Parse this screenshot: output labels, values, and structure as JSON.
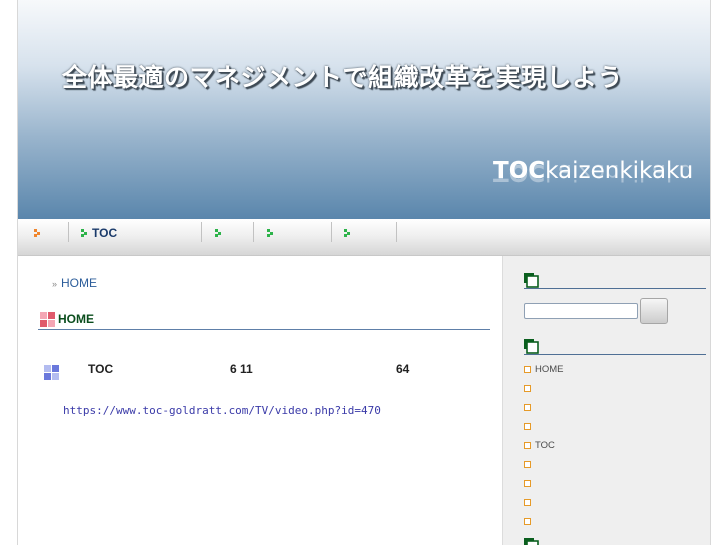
{
  "header": {
    "tagline": "全体最適のマネジメントで組織改革を実現しよう",
    "logo_bold": "TOC",
    "logo_rest": "kaizenkikaku"
  },
  "nav": {
    "items": [
      {
        "label": ""
      },
      {
        "label": "TOC"
      },
      {
        "label": ""
      },
      {
        "label": ""
      },
      {
        "label": ""
      }
    ],
    "colors": {
      "orange_arrow": "#f0852c",
      "green_arrow": "#2db34a"
    }
  },
  "main": {
    "breadcrumb": {
      "separator": "»",
      "label": "HOME"
    },
    "section_title": "HOME",
    "entry": {
      "col1": "TOC",
      "col2": "6 11",
      "col3": "64"
    },
    "link": "https://www.toc-goldratt.com/TV/video.php?id=470"
  },
  "sidebar": {
    "list": [
      "HOME",
      "",
      "",
      "",
      "TOC",
      "",
      "",
      "",
      ""
    ],
    "colors": {
      "head_rule": "#4f6f95",
      "bullet": "#e69a28"
    }
  }
}
